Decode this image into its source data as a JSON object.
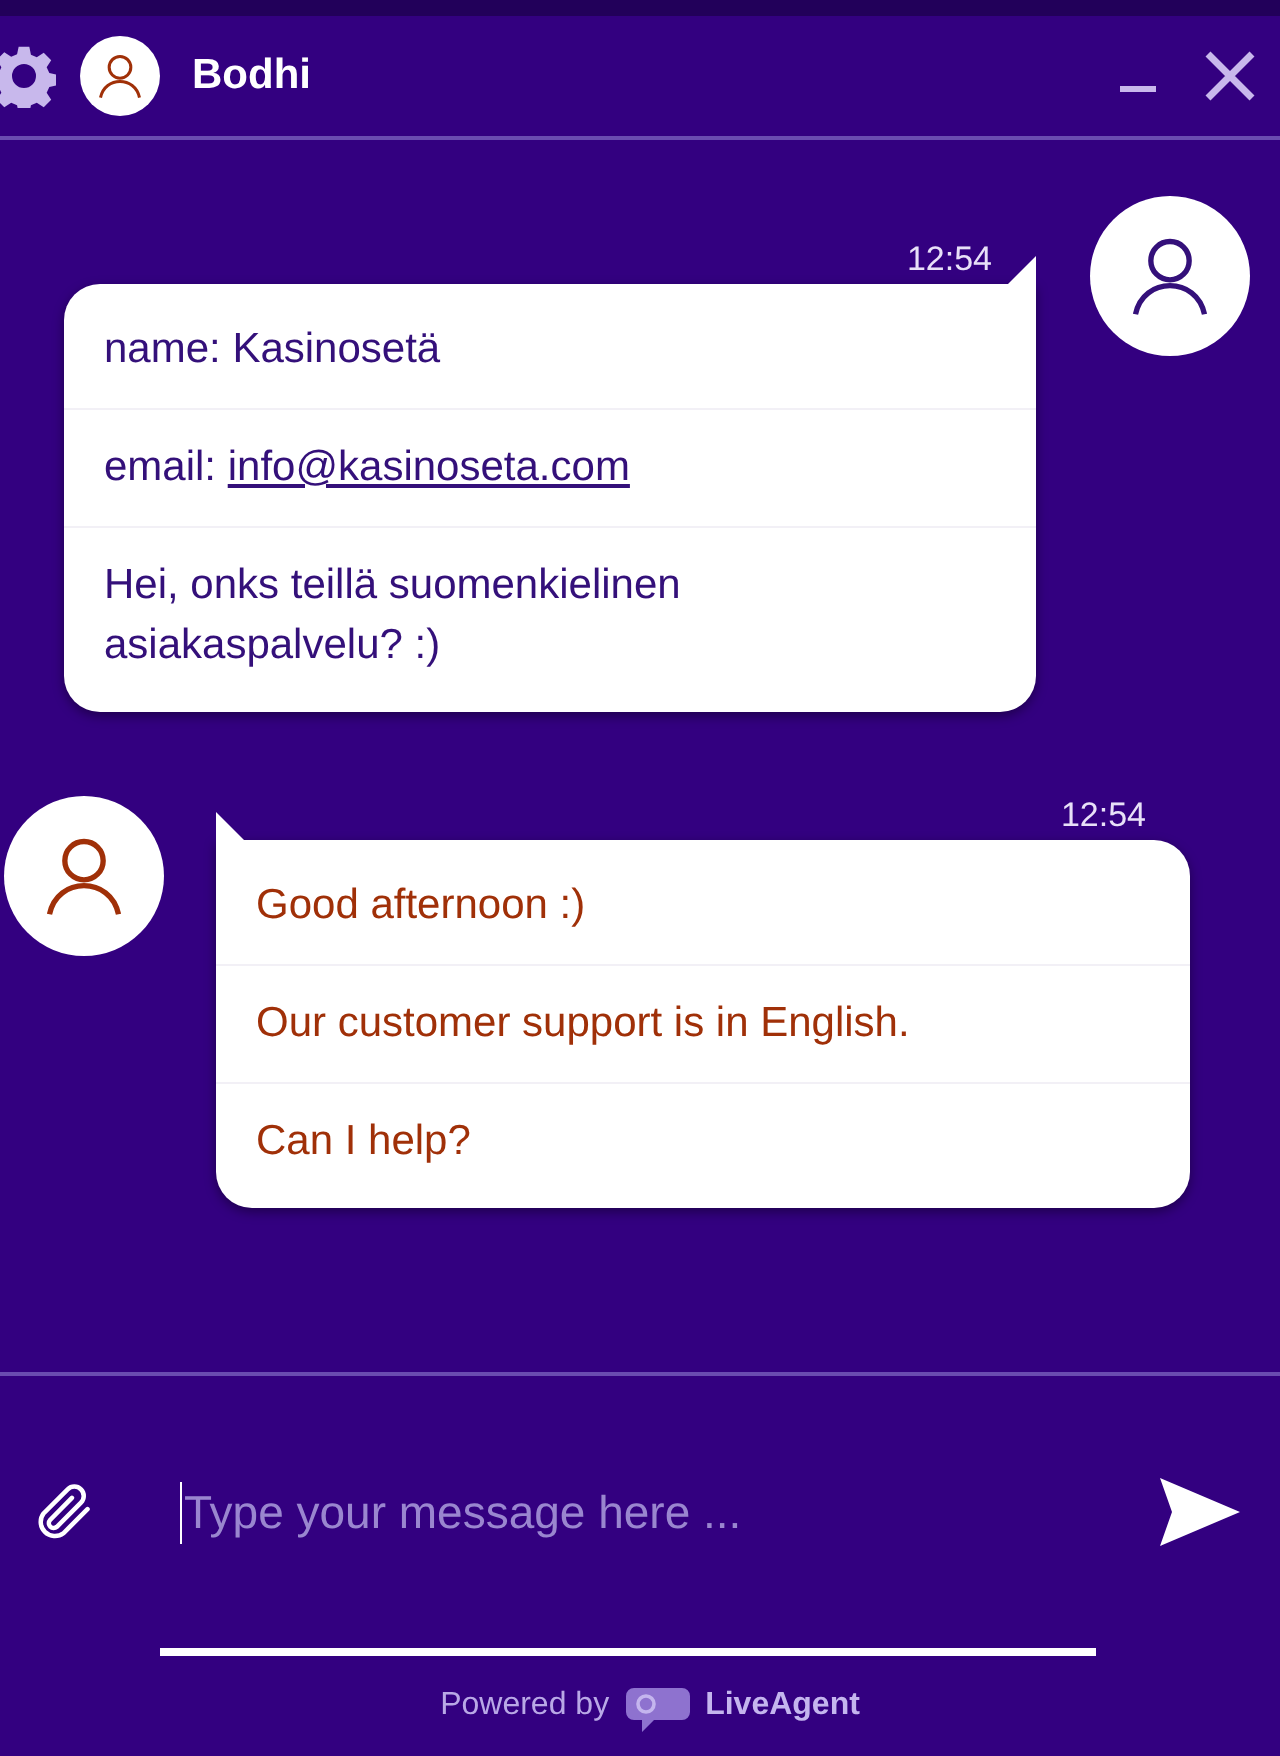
{
  "header": {
    "agent_name": "Bodhi"
  },
  "messages": [
    {
      "kind": "visitor",
      "time": "12:54",
      "lines": [
        {
          "text": "name: Kasinosetä"
        },
        {
          "text": "email: ",
          "link": "info@kasinoseta.com"
        },
        {
          "text": "Hei, onks teillä suomenkielinen asiakaspalvelu? :)"
        }
      ]
    },
    {
      "kind": "agent",
      "time": "12:54",
      "lines": [
        {
          "text": "Good afternoon :)"
        },
        {
          "text": "Our customer support is in English."
        },
        {
          "text": "Can I help?"
        }
      ]
    }
  ],
  "composer": {
    "placeholder": "Type your message here ..."
  },
  "footer": {
    "powered_by": "Powered by",
    "brand": "LiveAgent"
  }
}
